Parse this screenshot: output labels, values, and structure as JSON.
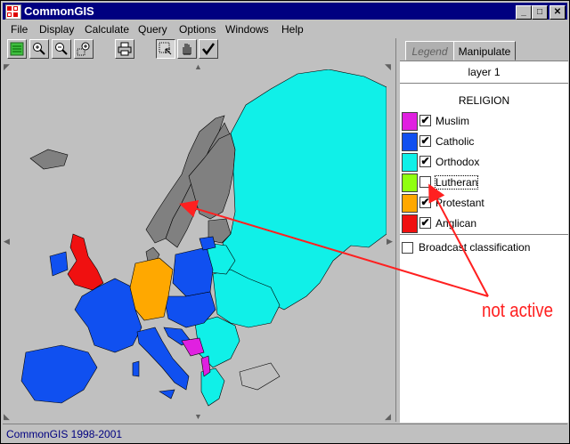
{
  "window": {
    "title": "CommonGIS"
  },
  "menu": [
    "File",
    "Display",
    "Calculate",
    "Query",
    "Options",
    "Windows",
    "Help"
  ],
  "toolbar": {
    "icons": [
      "map-layers-icon",
      "zoom-in-icon",
      "zoom-out-icon",
      "zoom-region-icon",
      "print-icon",
      "select-region-icon",
      "pan-hand-icon",
      "check-icon"
    ]
  },
  "tabs": {
    "legend": "Legend",
    "manipulate": "Manipulate"
  },
  "layer": {
    "name": "layer 1"
  },
  "legend": {
    "title": "RELIGION",
    "items": [
      {
        "label": "Muslim",
        "color": "#e020e0",
        "checked": true
      },
      {
        "label": "Catholic",
        "color": "#1050f0",
        "checked": true
      },
      {
        "label": "Orthodox",
        "color": "#10f0e8",
        "checked": true
      },
      {
        "label": "Lutheran",
        "color": "#90ff10",
        "checked": false
      },
      {
        "label": "Protestant",
        "color": "#ffa800",
        "checked": true
      },
      {
        "label": "Anglican",
        "color": "#f01010",
        "checked": true
      }
    ],
    "broadcast_label": "Broadcast classification",
    "broadcast_checked": false
  },
  "map": {
    "inactive_color": "#808080",
    "background": "#c0c0c0"
  },
  "status": {
    "text": "CommonGIS 1998-2001"
  },
  "annotation": {
    "text": "not active",
    "color": "#ff2020"
  }
}
